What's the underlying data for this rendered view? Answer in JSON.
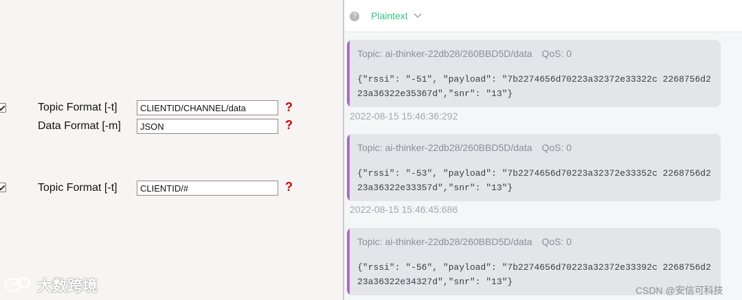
{
  "left": {
    "group1": {
      "topic_label": "Topic Format [-t]",
      "topic_value": "CLIENTID/CHANNEL/data",
      "data_label": "Data Format [-m]",
      "data_value": "JSON"
    },
    "group2": {
      "topic_label": "Topic Format [-t]",
      "topic_value": "CLIENTID/#"
    },
    "help_glyph": "?",
    "watermark": "大数跨境"
  },
  "right": {
    "format_selector": "Plaintext",
    "messages": [
      {
        "topic": "Topic: ai-thinker-22db28/260BBD5D/data",
        "qos": "QoS: 0",
        "payload": "{\"rssi\": \"-51\", \"payload\": \"7b2274656d70223a32372e33322c 2268756d223a36322e35367d\",\"snr\": \"13\"}",
        "timestamp": "2022-08-15 15:46:36:292"
      },
      {
        "topic": "Topic: ai-thinker-22db28/260BBD5D/data",
        "qos": "QoS: 0",
        "payload": "{\"rssi\": \"-53\", \"payload\": \"7b2274656d70223a32372e33352c 2268756d223a36322e33357d\",\"snr\": \"13\"}",
        "timestamp": "2022-08-15 15:46:45:686"
      },
      {
        "topic": "Topic: ai-thinker-22db28/260BBD5D/data",
        "qos": "QoS: 0",
        "payload": "{\"rssi\": \"-56\", \"payload\": \"7b2274656d70223a32372e33392c 2268756d223a36322e34327d\",\"snr\": \"13\"}"
      }
    ],
    "watermark": "CSDN @安信可科技"
  },
  "colors": {
    "accent": "#34c388",
    "message_bar": "#a86cc4",
    "help": "#d40000"
  }
}
